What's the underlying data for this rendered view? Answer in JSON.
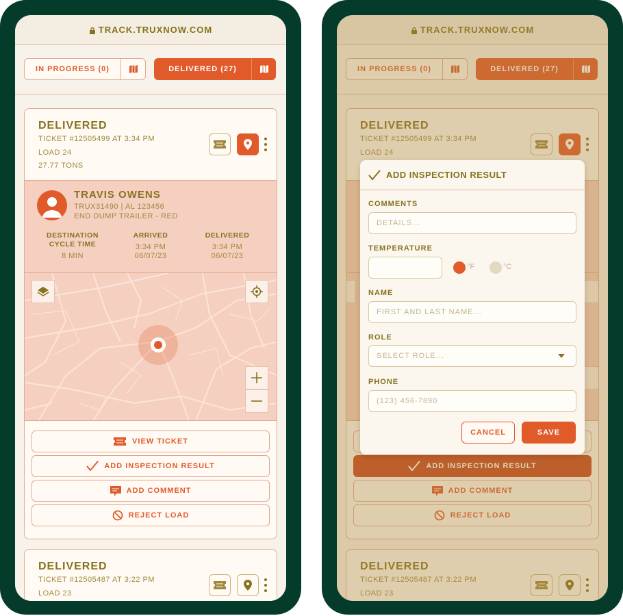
{
  "colors": {
    "brand": "#e15a2a",
    "frame": "#053b2b",
    "text_gold": "#86721f",
    "panel": "#f5cfbf"
  },
  "url": "TRACK.TRUXNOW.COM",
  "tabs": {
    "in_progress": "IN PROGRESS (0)",
    "delivered": "DELIVERED (27)"
  },
  "cards": [
    {
      "status": "DELIVERED",
      "ticket": "TICKET #12505499 AT 3:34 PM",
      "load": "LOAD 24",
      "weight": "27.77 TONS",
      "driver": {
        "name": "TRAVIS OWENS",
        "id_line": "TRUX31490 | AL 123456",
        "trailer": "END DUMP TRAILER - RED"
      },
      "stats": [
        {
          "label_1": "DESTINATION",
          "label_2": "CYCLE TIME",
          "value_1": "8 MIN",
          "value_2": ""
        },
        {
          "label_1": "ARRIVED",
          "label_2": "",
          "value_1": "3:34 PM",
          "value_2": "06/07/23"
        },
        {
          "label_1": "DELIVERED",
          "label_2": "",
          "value_1": "3:34 PM",
          "value_2": "06/07/23"
        }
      ]
    },
    {
      "status": "DELIVERED",
      "ticket": "TICKET #12505487 AT 3:22 PM",
      "load": "LOAD 23"
    }
  ],
  "actions": {
    "view_ticket": "VIEW TICKET",
    "add_inspection": "ADD INSPECTION RESULT",
    "add_comment": "ADD COMMENT",
    "reject_load": "REJECT LOAD"
  },
  "modal": {
    "title": "ADD INSPECTION RESULT",
    "comments_label": "COMMENTS",
    "comments_placeholder": "DETAILS...",
    "temperature_label": "TEMPERATURE",
    "unit_f": "°F",
    "unit_c": "°C",
    "selected_unit": "°F",
    "name_label": "NAME",
    "name_placeholder": "FIRST AND LAST NAME...",
    "role_label": "ROLE",
    "role_placeholder": "SELECT ROLE...",
    "phone_label": "PHONE",
    "phone_placeholder": "(123) 456-7890",
    "cancel": "CANCEL",
    "save": "SAVE"
  },
  "icons": [
    "lock-icon",
    "map-icon",
    "ticket-icon",
    "location-pin-icon",
    "kebab-menu-icon",
    "avatar-icon",
    "layers-icon",
    "crosshair-icon",
    "zoom-in-icon",
    "zoom-out-icon",
    "checkmark-icon",
    "comment-icon",
    "prohibited-icon",
    "chevron-down-icon"
  ]
}
